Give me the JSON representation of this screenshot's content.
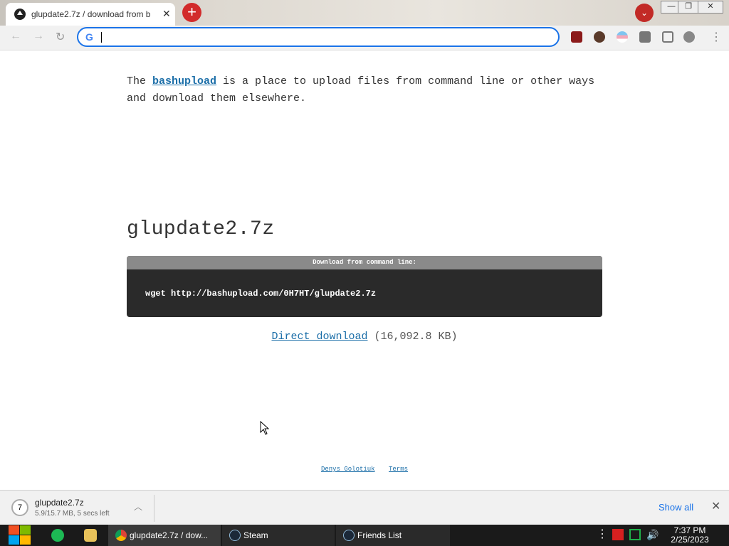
{
  "browser": {
    "tab_title": "glupdate2.7z / download from b",
    "tab_close": "✕",
    "new_tab": "+",
    "profile_dropdown": "⌄",
    "window_buttons": [
      "—",
      "❐",
      "✕"
    ],
    "omnibox_value": "",
    "google_icon_letter": "G"
  },
  "page": {
    "intro_prefix": "The ",
    "intro_link": "bashupload",
    "intro_suffix": " is a place to upload files from command line or other ways and download them elsewhere.",
    "filename": "glupdate2.7z",
    "cmd_header": "Download from command line:",
    "cmd_text": "wget http://bashupload.com/0H7HT/glupdate2.7z",
    "direct_download_label": "Direct download",
    "file_size": "(16,092.8 KB)",
    "footer_links": [
      "Denys Golotiuk",
      "Terms"
    ]
  },
  "download_bar": {
    "file_name": "glupdate2.7z",
    "status": "5.9/15.7 MB, 5 secs left",
    "show_all": "Show all",
    "close": "✕"
  },
  "taskbar": {
    "tasks": [
      {
        "label": "glupdate2.7z / dow...",
        "icon": "chrome-icon"
      },
      {
        "label": "Steam",
        "icon": "steam-icon"
      },
      {
        "label": "Friends List",
        "icon": "steam-icon"
      }
    ],
    "time": "7:37 PM",
    "date": "2/25/2023"
  },
  "colors": {
    "link": "#1b6ea8",
    "accent": "#1a73e8",
    "new_tab_red": "#d22b2b"
  }
}
